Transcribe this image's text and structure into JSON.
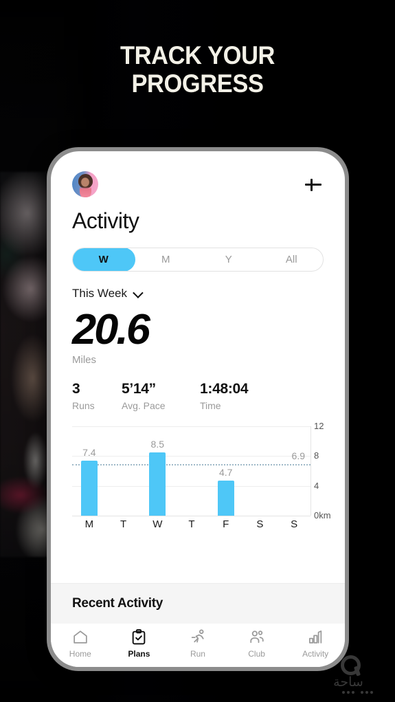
{
  "headline": {
    "line1": "TRACK YOUR",
    "line2": "PROGRESS"
  },
  "app": {
    "avatar_name": "user-avatar",
    "add_button": "+",
    "page_title": "Activity",
    "segmented": {
      "options": [
        {
          "label": "W",
          "active": true
        },
        {
          "label": "M",
          "active": false
        },
        {
          "label": "Y",
          "active": false
        },
        {
          "label": "All",
          "active": false
        }
      ]
    },
    "period_selector": {
      "label": "This Week",
      "chevron": "chevron-down"
    },
    "primary_stat": {
      "value": "20.6",
      "unit": "Miles"
    },
    "secondary_stats": [
      {
        "value": "3",
        "label": "Runs"
      },
      {
        "value": "5’14”",
        "label": "Avg. Pace"
      },
      {
        "value": "1:48:04",
        "label": "Time"
      }
    ],
    "recent_activity_title": "Recent Activity",
    "tabs": [
      {
        "label": "Home",
        "icon": "home-icon",
        "active": false
      },
      {
        "label": "Plans",
        "icon": "clipboard-check-icon",
        "active": true
      },
      {
        "label": "Run",
        "icon": "running-person-icon",
        "active": false
      },
      {
        "label": "Club",
        "icon": "people-icon",
        "active": false
      },
      {
        "label": "Activity",
        "icon": "bar-chart-icon",
        "active": false
      }
    ]
  },
  "chart_data": {
    "type": "bar",
    "title": "",
    "xlabel": "",
    "ylabel": "km",
    "categories": [
      "M",
      "T",
      "W",
      "T",
      "F",
      "S",
      "S"
    ],
    "values": [
      7.4,
      null,
      8.5,
      null,
      4.7,
      null,
      null
    ],
    "value_labels": [
      "7.4",
      "",
      "8.5",
      "",
      "4.7",
      "",
      ""
    ],
    "ylim": [
      0,
      12
    ],
    "yticks": [
      0,
      4,
      8,
      12
    ],
    "ytick_labels": [
      "0km",
      "4",
      "8",
      "12"
    ],
    "grid": true,
    "legend": "none",
    "average_line": {
      "value": 6.9,
      "label": "6.9",
      "style": "dotted"
    },
    "bar_color": "#4ec7f7"
  },
  "watermark": {
    "text": "ساحة"
  },
  "colors": {
    "accent": "#4ec7f7",
    "headline": "#f3f1e7",
    "muted_text": "#9a9a9a",
    "phone_frame": "#8c8c8c",
    "band_bg": "#f5f5f5"
  }
}
